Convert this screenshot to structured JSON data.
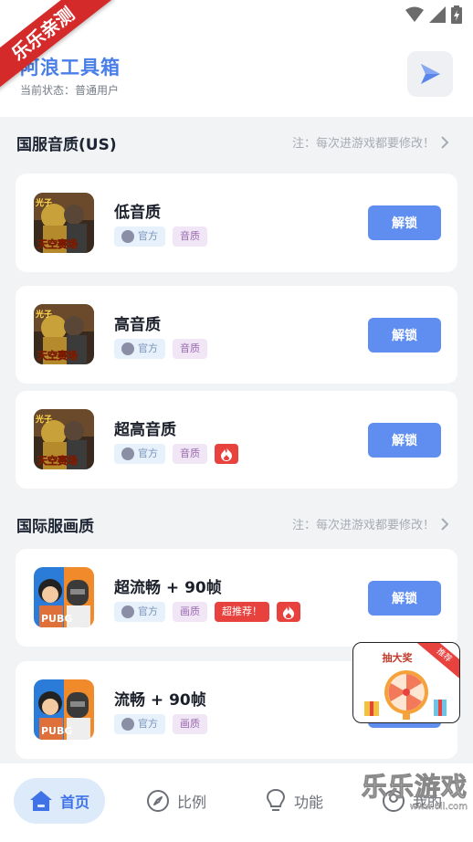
{
  "ribbon": {
    "text": "乐乐亲测"
  },
  "header": {
    "title": "阿浪工具箱",
    "status": "当前状态：普通用户"
  },
  "sections": [
    {
      "title": "国服音质(US)",
      "note": "注：每次进游戏都要修改！"
    },
    {
      "title": "国际服画质",
      "note": "注：每次进游戏都要修改！"
    }
  ],
  "cards": [
    {
      "title": "低音质",
      "tag_official": "官方",
      "tag_cat": "音质",
      "hot": "",
      "button": "解锁"
    },
    {
      "title": "高音质",
      "tag_official": "官方",
      "tag_cat": "音质",
      "hot": "",
      "button": "解锁"
    },
    {
      "title": "超高音质",
      "tag_official": "官方",
      "tag_cat": "音质",
      "hot": "",
      "button": "解锁"
    },
    {
      "title": "超流畅 + 90帧",
      "tag_official": "官方",
      "tag_cat": "画质",
      "hot": "超推荐！",
      "button": "解锁"
    },
    {
      "title": "流畅 + 90帧",
      "tag_official": "官方",
      "tag_cat": "画质",
      "hot": "",
      "button": "解锁"
    }
  ],
  "game_icon_labels": {
    "classic_top": "光子",
    "classic_bottom": "天空赛场",
    "intl": "PUBG"
  },
  "float_ad": {
    "title": "抽大奖",
    "corner": "推荐"
  },
  "nav": {
    "home": "首页",
    "ratio": "比例",
    "function": "功能",
    "mine": "我的"
  },
  "watermark": {
    "big": "乐乐游戏",
    "small": "www.6ll.com"
  },
  "colors": {
    "accent": "#5f8ef0",
    "title_blue": "#4a7ee8",
    "hot_red": "#e8423f"
  }
}
